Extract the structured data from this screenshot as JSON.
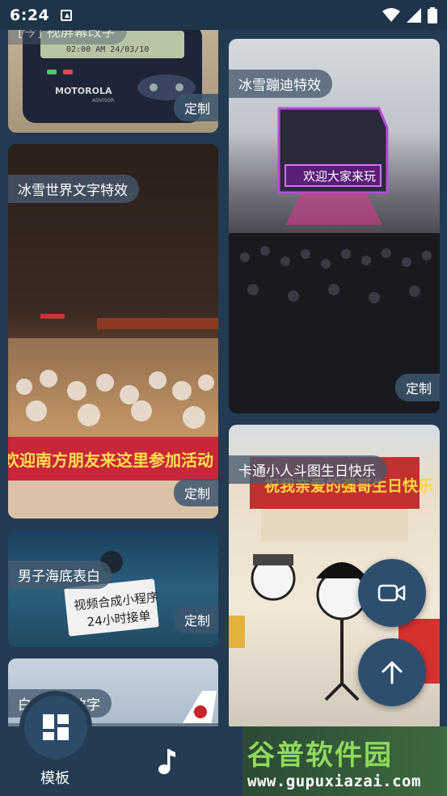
{
  "status_bar": {
    "time": "6:24"
  },
  "cards": [
    {
      "label": "[今] 视屏幕改字",
      "custom": "定制",
      "snippet": "MOTOROLA",
      "snippet_sub": "ADVISOR",
      "pager_time": "02:00 AM   24/03/10"
    },
    {
      "label": "冰雪世界文字特效",
      "custom": "定制",
      "banner_text": "欢迎南方朋友来这里参加活动"
    },
    {
      "label": "冰雪蹦迪特效",
      "custom": "定制",
      "sign_text": "欢迎大家来玩"
    },
    {
      "label": "男子海底表白",
      "custom": "定制",
      "sign_line1": "视频合成小程序",
      "sign_line2": "24小时接单"
    },
    {
      "label": "卡通小人斗图生日快乐",
      "banner_text": "祝我亲爱的强哥生日快乐"
    },
    {
      "label": "白…起飞改字"
    }
  ],
  "bottom_nav": {
    "template_label": "模板"
  },
  "watermark": {
    "title": "谷普软件园",
    "url": "www.gupuxiazai.com"
  }
}
